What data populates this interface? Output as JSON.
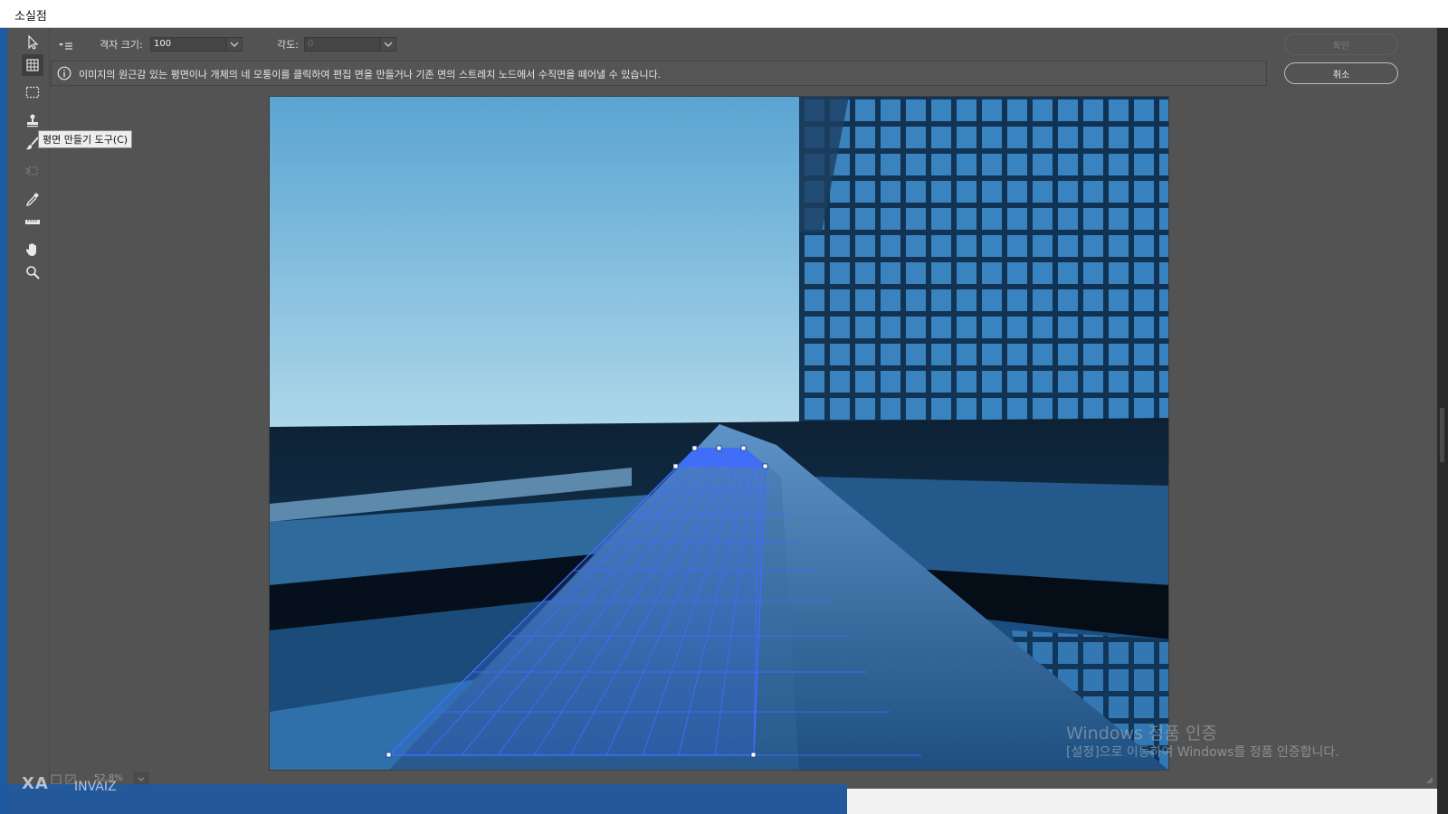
{
  "window": {
    "title": "소실점"
  },
  "toolbar": {
    "grid_size_label": "격자 크기:",
    "grid_size_value": "100",
    "angle_label": "각도:",
    "angle_value": "0"
  },
  "info": {
    "message": "이미지의 원근감 있는 평면이나 개체의 네 모퉁이를 클릭하여 편집 면을 만들거나 기존 면의 스트레치 노드에서 수직면을 떼어낼 수 있습니다."
  },
  "buttons": {
    "ok": "확인",
    "cancel": "취소"
  },
  "tools": [
    {
      "name": "edit-plane-tool",
      "icon": "arrow-pointer-icon"
    },
    {
      "name": "create-plane-tool",
      "icon": "grid-plane-icon",
      "active": true
    },
    {
      "name": "marquee-tool",
      "icon": "dashed-rect-icon"
    },
    {
      "name": "stamp-tool",
      "icon": "stamp-icon"
    },
    {
      "name": "brush-tool",
      "icon": "brush-icon"
    },
    {
      "name": "transform-tool",
      "icon": "transform-icon"
    },
    {
      "name": "eyedropper-tool",
      "icon": "eyedropper-icon"
    },
    {
      "name": "measure-tool",
      "icon": "ruler-icon"
    },
    {
      "name": "hand-tool",
      "icon": "hand-icon"
    },
    {
      "name": "zoom-tool",
      "icon": "magnifier-icon"
    }
  ],
  "tooltip": {
    "text": "평면 만들기 도구(C)"
  },
  "status": {
    "zoom": "52.8%"
  },
  "watermark": {
    "title": "Windows 정품 인증",
    "subtitle": "[설정]으로 이동하여 Windows를 정품 인증합니다."
  },
  "brand": {
    "logo": "XA",
    "name": "INVAIZ"
  },
  "colors": {
    "panel": "#535353",
    "grid": "#3f6cff",
    "sky": "#b2d9ea"
  }
}
